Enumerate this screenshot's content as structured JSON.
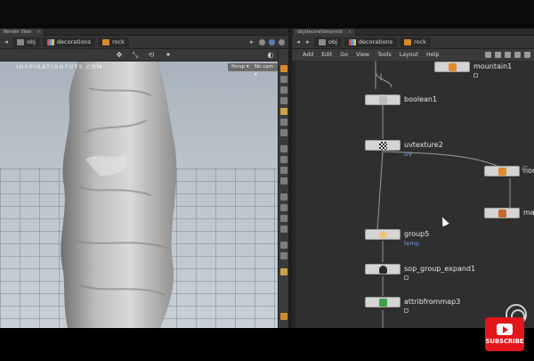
{
  "tabs": {
    "render_view": "Render View",
    "network_path": "obj/decorations/rock"
  },
  "viewport_path": {
    "obj": "obj",
    "decorations": "decorations",
    "rock": "rock"
  },
  "network_path": {
    "obj": "obj",
    "decorations": "decorations",
    "rock": "rock"
  },
  "viewport": {
    "watermark": "INSPIRATIONTUTS.COM",
    "persp_button": "Persp ▾",
    "camera_button": "No cam ▾"
  },
  "network_menu": [
    "Add",
    "Edit",
    "Go",
    "View",
    "Tools",
    "Layout",
    "Help"
  ],
  "nodes": {
    "mountain1": {
      "label": "mountain1",
      "color": "#e0892e"
    },
    "boolean1": {
      "label": "boolean1"
    },
    "uvtexture2": {
      "label": "uvtexture2",
      "sub": "UV"
    },
    "normal": {
      "label": "nor",
      "color": "#e0892e"
    },
    "material": {
      "label": "mat",
      "color": "#c86a28"
    },
    "group5": {
      "label": "group5",
      "sub": "temp",
      "color": "#f1c27d"
    },
    "sop_group_expand1": {
      "label": "sop_group_expand1"
    },
    "attribfrommap3": {
      "label": "attribfrommap3",
      "color": "#3f9e4a"
    }
  },
  "overlay": {
    "subscribe": "SUBSCRIBE",
    "network_logo_letter": "G"
  },
  "colors": {
    "accent_blue": "#6fa0e8",
    "subscribe_red": "#e3161b",
    "network_bg": "#2f2f2f"
  }
}
